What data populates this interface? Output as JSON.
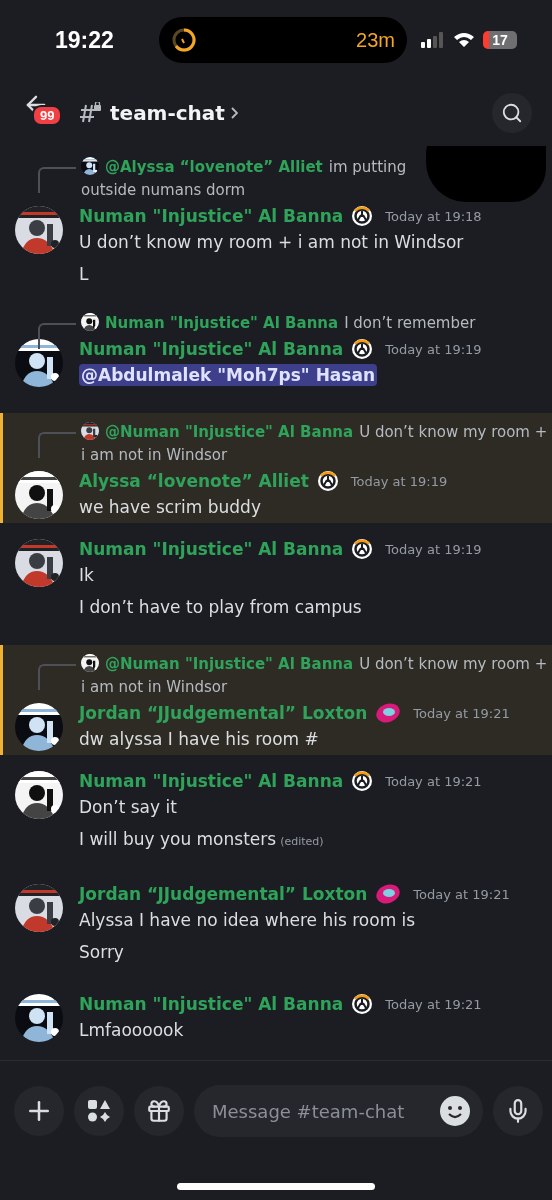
{
  "status_bar": {
    "time": "19:22",
    "activity": "23m",
    "battery": "17"
  },
  "header": {
    "unread_badge": "99",
    "channel": "team-chat"
  },
  "messages": [
    {
      "highlighted": false,
      "reply": {
        "author": "@Alyssa “lovenote” Alliet",
        "text": "im putting",
        "redacted": true,
        "continuation": "outside numans dorm"
      },
      "author": "Numan \"Injustice\" Al Banna",
      "badge": {
        "kind": "ring"
      },
      "time": "Today at 19:18",
      "lines": [
        {
          "kind": "text",
          "text": "U don’t know my room + i am not in Windsor"
        },
        {
          "kind": "text",
          "text": "L"
        }
      ]
    },
    {
      "highlighted": false,
      "reply": {
        "author": "Numan \"Injustice\" Al Banna",
        "text": "I don’t remember"
      },
      "author": "Numan \"Injustice\" Al Banna",
      "badge": {
        "kind": "ring"
      },
      "time": "Today at 19:19",
      "lines": [
        {
          "kind": "mention",
          "text": "@Abdulmalek \"Moh7ps\" Hasan"
        }
      ]
    },
    {
      "highlighted": true,
      "reply": {
        "author": "@Numan \"Injustice\" Al Banna",
        "text": "U don’t know my room + i am not in Windsor"
      },
      "author": "Alyssa “lovenote” Alliet",
      "badge": {
        "kind": "ring"
      },
      "time": "Today at 19:19",
      "lines": [
        {
          "kind": "text",
          "text": "we have scrim buddy"
        }
      ]
    },
    {
      "highlighted": false,
      "author": "Numan \"Injustice\" Al Banna",
      "badge": {
        "kind": "ring"
      },
      "time": "Today at 19:19",
      "lines": [
        {
          "kind": "text",
          "text": "Ik"
        },
        {
          "kind": "text",
          "text": "I don’t have to play from campus"
        }
      ]
    },
    {
      "highlighted": true,
      "reply": {
        "author": "@Numan \"Injustice\" Al Banna",
        "text": "U don’t know my room + i am not in Windsor"
      },
      "author": "Jordan “JJudgemental” Loxton",
      "badge": {
        "kind": "orb"
      },
      "time": "Today at 19:21",
      "lines": [
        {
          "kind": "text",
          "text": "dw alyssa I have his room #"
        }
      ]
    },
    {
      "highlighted": false,
      "author": "Numan \"Injustice\" Al Banna",
      "badge": {
        "kind": "ring"
      },
      "time": "Today at 19:21",
      "lines": [
        {
          "kind": "text",
          "text": "Don’t say it"
        },
        {
          "kind": "text",
          "text": "I will buy you monsters",
          "edited": "(edited)"
        }
      ]
    },
    {
      "highlighted": false,
      "author": "Jordan “JJudgemental” Loxton",
      "badge": {
        "kind": "orb"
      },
      "time": "Today at 19:21",
      "lines": [
        {
          "kind": "text",
          "text": "Alyssa I have no idea where his room is"
        },
        {
          "kind": "text",
          "text": "Sorry"
        }
      ]
    },
    {
      "highlighted": false,
      "author": "Numan \"Injustice\" Al Banna",
      "badge": {
        "kind": "ring"
      },
      "time": "Today at 19:21",
      "lines": [
        {
          "kind": "text",
          "text": "Lmfaoooook"
        }
      ]
    }
  ],
  "composer": {
    "placeholder": "Message #team-chat"
  }
}
